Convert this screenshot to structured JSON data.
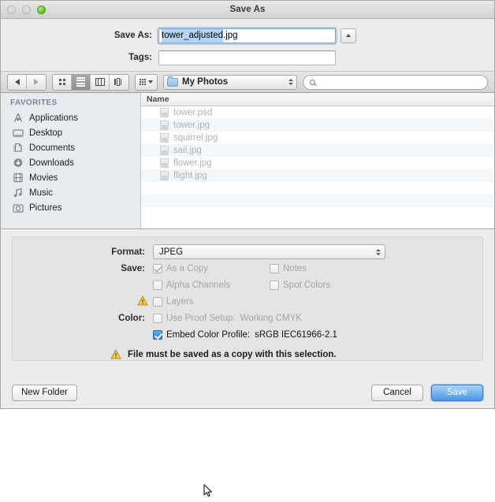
{
  "window": {
    "title": "Save As",
    "traffic_lights": [
      "close-inactive",
      "minimize-inactive",
      "zoom-green"
    ]
  },
  "name_fields": {
    "save_as_label": "Save As:",
    "save_as_value_selected": "tower_adjusted",
    "save_as_value_rest": ".jpg",
    "tags_label": "Tags:",
    "tags_value": "",
    "tags_placeholder": "",
    "expand_button_icon": "chevron-up-icon"
  },
  "toolbar": {
    "back_icon": "chevron-left-icon",
    "forward_icon": "chevron-right-icon",
    "view_modes": [
      {
        "name": "icon-view",
        "selected": false
      },
      {
        "name": "list-view",
        "selected": true
      },
      {
        "name": "column-view",
        "selected": false
      },
      {
        "name": "coverflow-view",
        "selected": false
      }
    ],
    "arrange_icon": "grid-icon",
    "path_label": "My Photos",
    "path_icon": "folder-icon",
    "search_placeholder": "",
    "search_value": "",
    "search_icon": "search-icon"
  },
  "sidebar": {
    "header": "FAVORITES",
    "items": [
      {
        "label": "Applications",
        "icon": "applications-icon"
      },
      {
        "label": "Desktop",
        "icon": "desktop-icon"
      },
      {
        "label": "Documents",
        "icon": "documents-icon"
      },
      {
        "label": "Downloads",
        "icon": "downloads-icon"
      },
      {
        "label": "Movies",
        "icon": "movies-icon"
      },
      {
        "label": "Music",
        "icon": "music-icon"
      },
      {
        "label": "Pictures",
        "icon": "pictures-icon"
      }
    ]
  },
  "filelist": {
    "column_header": "Name",
    "files": [
      {
        "name": "tower.psd",
        "icon": "file-icon",
        "dimmed": true
      },
      {
        "name": "tower.jpg",
        "icon": "file-icon",
        "dimmed": true
      },
      {
        "name": "squirrel.jpg",
        "icon": "file-icon",
        "dimmed": true
      },
      {
        "name": "sail.jpg",
        "icon": "file-icon",
        "dimmed": true
      },
      {
        "name": "flower.jpg",
        "icon": "file-icon",
        "dimmed": true
      },
      {
        "name": "flight.jpg",
        "icon": "file-icon",
        "dimmed": true
      }
    ]
  },
  "options": {
    "format_label": "Format:",
    "format_value": "JPEG",
    "save_label": "Save:",
    "color_label": "Color:",
    "checkboxes": {
      "as_a_copy": {
        "label": "As a Copy",
        "checked": true,
        "enabled": false
      },
      "notes": {
        "label": "Notes",
        "checked": false,
        "enabled": false
      },
      "alpha_channels": {
        "label": "Alpha Channels",
        "checked": false,
        "enabled": false
      },
      "spot_colors": {
        "label": "Spot Colors",
        "checked": false,
        "enabled": false
      },
      "layers": {
        "label": "Layers",
        "checked": false,
        "enabled": false,
        "warning": true
      },
      "use_proof_setup": {
        "label": "Use Proof Setup:",
        "value": "Working CMYK",
        "checked": false,
        "enabled": false
      },
      "embed_color_profile": {
        "label": "Embed Color Profile:",
        "value": "sRGB IEC61966-2.1",
        "checked": true,
        "enabled": true
      }
    },
    "warning_message": "File must be saved as a copy with this selection.",
    "warning_icon": "warning-triangle-icon",
    "accent_color": "#3d7cc4",
    "warning_color": "#e8b63a"
  },
  "footer": {
    "new_folder_label": "New Folder",
    "cancel_label": "Cancel",
    "save_label": "Save"
  }
}
